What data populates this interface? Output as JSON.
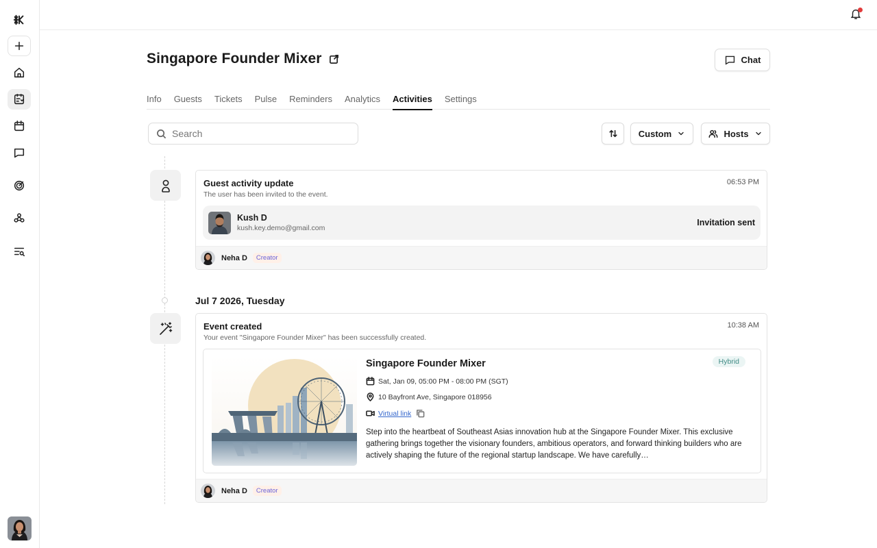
{
  "sidebar": {
    "logo_icon": "asterisk-k-logo",
    "items": [
      {
        "name": "new",
        "icon": "plus-icon"
      },
      {
        "name": "home",
        "icon": "home-icon"
      },
      {
        "name": "events",
        "icon": "event-list-icon"
      },
      {
        "name": "calendar",
        "icon": "calendar-icon"
      },
      {
        "name": "messages",
        "icon": "message-icon"
      },
      {
        "name": "insights",
        "icon": "target-icon"
      },
      {
        "name": "integrations",
        "icon": "webhook-icon"
      },
      {
        "name": "search-list",
        "icon": "list-search-icon"
      }
    ]
  },
  "header": {
    "title": "Singapore Founder Mixer",
    "chat_label": "Chat"
  },
  "tabs": [
    {
      "label": "Info"
    },
    {
      "label": "Guests"
    },
    {
      "label": "Tickets"
    },
    {
      "label": "Pulse"
    },
    {
      "label": "Reminders"
    },
    {
      "label": "Analytics"
    },
    {
      "label": "Activities",
      "active": true
    },
    {
      "label": "Settings"
    }
  ],
  "controls": {
    "search_placeholder": "Search",
    "filter_label": "Custom",
    "hosts_label": "Hosts"
  },
  "activities": {
    "guest_update": {
      "title": "Guest activity update",
      "subtitle": "The user has been invited to the event.",
      "time": "06:53 PM",
      "guest_name": "Kush D",
      "guest_email": "kush.key.demo@gmail.com",
      "status": "Invitation sent",
      "actor_name": "Neha D",
      "actor_role": "Creator"
    },
    "date_label": "Jul 7 2026, Tuesday",
    "event_created": {
      "title": "Event created",
      "subtitle": "Your event \"Singapore Founder Mixer\" has been successfully created.",
      "time": "10:38 AM",
      "event_name": "Singapore Founder Mixer",
      "event_type": "Hybrid",
      "datetime": "Sat, Jan 09, 05:00 PM - 08:00 PM (SGT)",
      "location": "10 Bayfront Ave, Singapore 018956",
      "virtual_link_label": "Virtual link",
      "description": "Step into the heartbeat of Southeast Asias innovation hub at the Singapore Founder Mixer. This exclusive gathering brings together the visionary founders, ambitious operators, and forward thinking builders who are actively shaping the future of the regional startup landscape. We have carefully…",
      "actor_name": "Neha D",
      "actor_role": "Creator"
    }
  },
  "colors": {
    "accent": "#111111",
    "notification_dot": "#e23b3b",
    "creator_badge_text": "#6b63d8",
    "hybrid_badge_text": "#3f8a84",
    "link": "#3366cc"
  }
}
